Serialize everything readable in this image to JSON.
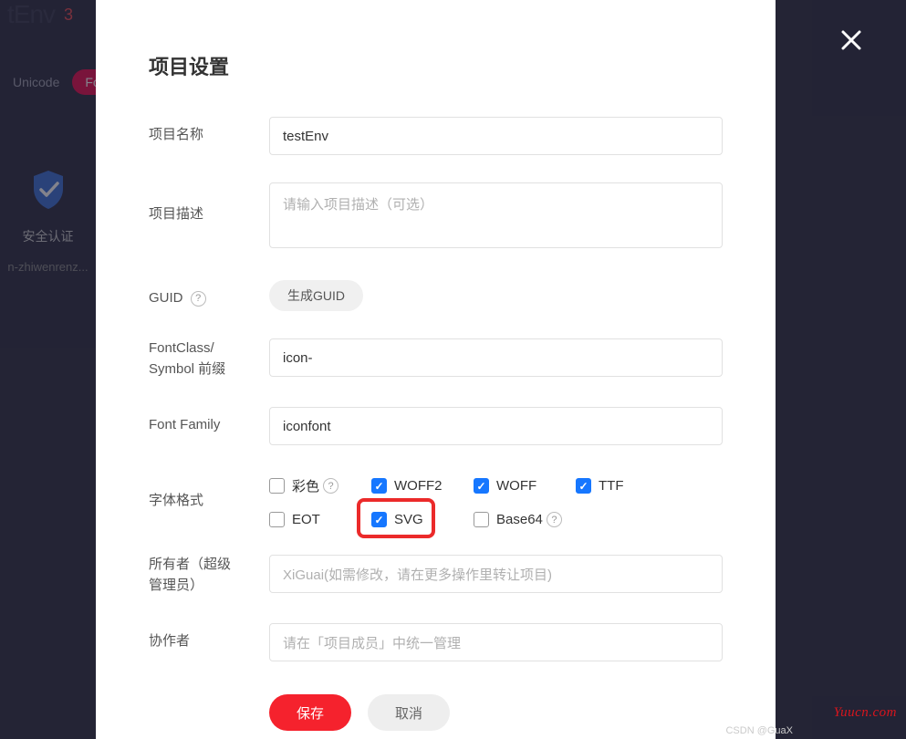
{
  "background": {
    "title": "tEnv",
    "count": "3",
    "tabs": {
      "unicode": "Unicode",
      "font": "Fo"
    },
    "card": {
      "label": "安全认证",
      "code": "n-zhiwenrenz..."
    }
  },
  "modal": {
    "title": "项目设置",
    "labels": {
      "name": "项目名称",
      "desc": "项目描述",
      "guid": "GUID",
      "prefix_line1": "FontClass/",
      "prefix_line2": "Symbol 前缀",
      "family": "Font Family",
      "format": "字体格式",
      "owner_line1": "所有者（超级",
      "owner_line2": "管理员）",
      "collab": "协作者"
    },
    "values": {
      "name": "testEnv",
      "desc_placeholder": "请输入项目描述（可选）",
      "guid_btn": "生成GUID",
      "prefix": "icon-",
      "family": "iconfont",
      "owner": "XiGuai(如需修改，请在更多操作里转让项目)",
      "collab": "请在「项目成员」中统一管理"
    },
    "formats": {
      "color": "彩色",
      "woff2": "WOFF2",
      "woff": "WOFF",
      "ttf": "TTF",
      "eot": "EOT",
      "svg": "SVG",
      "base64": "Base64"
    },
    "buttons": {
      "save": "保存",
      "cancel": "取消"
    }
  },
  "watermark": {
    "right": "Yuucn.com",
    "left": "CSDN @GuaX"
  }
}
